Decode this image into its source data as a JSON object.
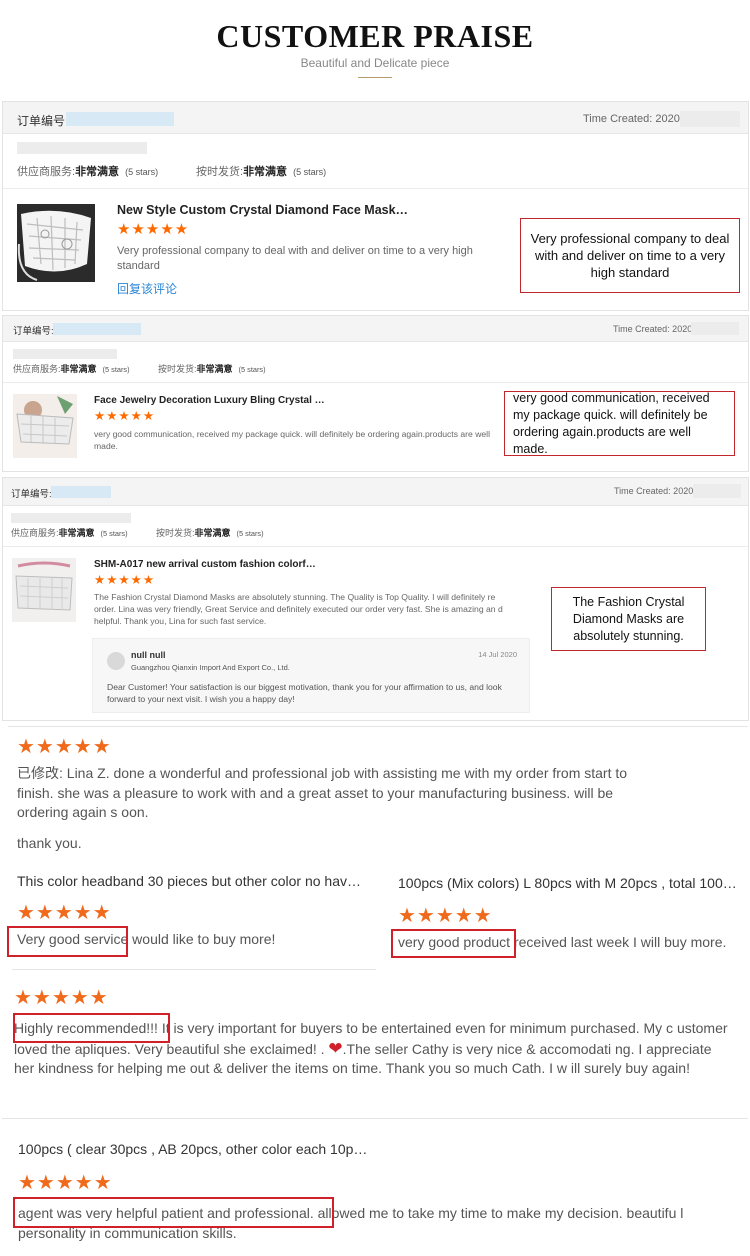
{
  "header": {
    "title": "CUSTOMER PRAISE",
    "subtitle": "Beautiful and Delicate piece"
  },
  "orders": [
    {
      "order_label": "订单编号:",
      "time_label": "Time Created: 2020-",
      "supplier_service_label": "供应商服务:",
      "supplier_service_value": "非常满意",
      "supplier_service_stars": "(5 stars)",
      "shipping_label": "按时发货:",
      "shipping_value": "非常满意",
      "shipping_stars": "(5 stars)",
      "product_title": "New Style Custom Crystal Diamond Face Mask…",
      "stars": "★★★★★",
      "review_text": "Very professional company to deal with and deliver on time to a very high standard",
      "reply_link": "回复该评论",
      "callout": "Very professional company to deal with and deliver on time to a very high standard"
    },
    {
      "order_label": "订单编号:",
      "time_label": "Time Created: 2020-",
      "supplier_service_label": "供应商服务:",
      "supplier_service_value": "非常满意",
      "supplier_service_stars": "(5 stars)",
      "shipping_label": "按时发货:",
      "shipping_value": "非常满意",
      "shipping_stars": "(5 stars)",
      "product_title": "Face Jewelry Decoration Luxury Bling Crystal …",
      "stars": "★★★★★",
      "review_text": "very good communication, received my package quick. will definitely be ordering again.products are well made.",
      "callout": "very good communication, received my package quick. will definitely be ordering again.products are well made."
    },
    {
      "order_label": "订单编号:",
      "time_label": "Time Created: 2020-",
      "supplier_service_label": "供应商服务:",
      "supplier_service_value": "非常满意",
      "supplier_service_stars": "(5 stars)",
      "shipping_label": "按时发货:",
      "shipping_value": "非常满意",
      "shipping_stars": "(5 stars)",
      "product_title": "SHM-A017 new arrival custom fashion colorf…",
      "stars": "★★★★★",
      "review_text": "The Fashion Crystal Diamond Masks are absolutely stunning.  The Quality is Top Quality.  I will definitely re order.  Lina was very friendly, Great Service and definitely executed our order very fast.  She is amazing an d helpful.  Thank you, Lina for such fast service.",
      "callout": "The Fashion Crystal Diamond Masks are absolutely stunning.",
      "seller_reply": {
        "name": "null null",
        "company": "Guangzhou Qianxin Import And Export Co., Ltd.",
        "date": "14 Jul 2020",
        "text": "Dear Customer! Your satisfaction is our biggest motivation, thank you for your affirmation to us, and look forward to your next visit. I wish you a happy day!"
      }
    }
  ],
  "reviews": {
    "r1": {
      "stars": "★★★★★",
      "prefix": "已修改:",
      "text": " Lina Z. done a wonderful and professional job with assisting me with my order from start to finish. she was a pleasure to work with and a great asset to your manufacturing business. will be ordering again s oon.",
      "closing": "thank you."
    },
    "r2": {
      "title": "This color headband 30 pieces but other color no hav…",
      "stars": "★★★★★",
      "highlight": "Very good service",
      "rest": " would like to buy more!"
    },
    "r3": {
      "title": "100pcs (Mix colors) L 80pcs with M 20pcs , total 100…",
      "stars": "★★★★★",
      "highlight": "very good product",
      "rest": " received last week I will buy more."
    },
    "r4": {
      "stars": "★★★★★",
      "highlight": "Highly recommended!!!",
      "text_a": " It is very important for buyers to be entertained even for minimum purchased. My c ustomer loved the  apliques. Very beautiful she exclaimed! .  ",
      "heart": "❤",
      "text_b": ".The seller Cathy is very nice & accomodati ng. I appreciate her kindness   for helping me out & deliver the  items on time.  Thank you so much Cath. I w ill surely buy again!"
    },
    "r5": {
      "title": "100pcs ( clear 30pcs , AB 20pcs, other color each 10p…",
      "stars": "★★★★★",
      "highlight": "agent was very helpful patient and professional.",
      "rest": " allowed me to take my time to make my decision. beautifu l personality in communication skills."
    }
  },
  "colors": {
    "star_orange": "#ff6a00",
    "highlight_red": "#d0202a",
    "link_blue": "#2a86d6",
    "accent_gold": "#b99b6b"
  }
}
